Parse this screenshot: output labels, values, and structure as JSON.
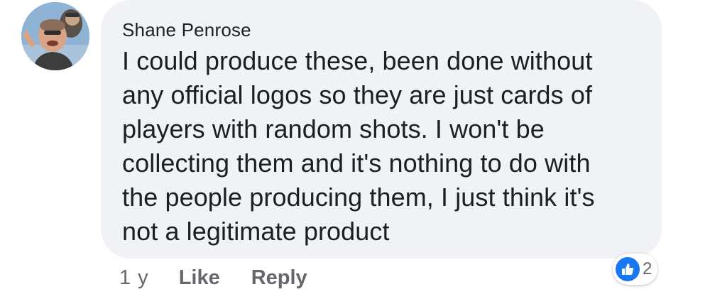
{
  "comment": {
    "author": "Shane Penrose",
    "text": "I could produce these, been done without\nany official logos so they are just cards of\nplayers with random shots. I won't be\ncollecting them and it's nothing to do with\nthe people producing them, I just think it's\nnot a legitimate product",
    "age": "1 y",
    "like_label": "Like",
    "reply_label": "Reply",
    "reaction_count": "2",
    "reaction_icon": "thumbs-up-icon"
  },
  "colors": {
    "bubble_bg": "#f0f2f5",
    "text": "#1c1e21",
    "muted": "#65676b",
    "like_blue": "#1877f2"
  }
}
